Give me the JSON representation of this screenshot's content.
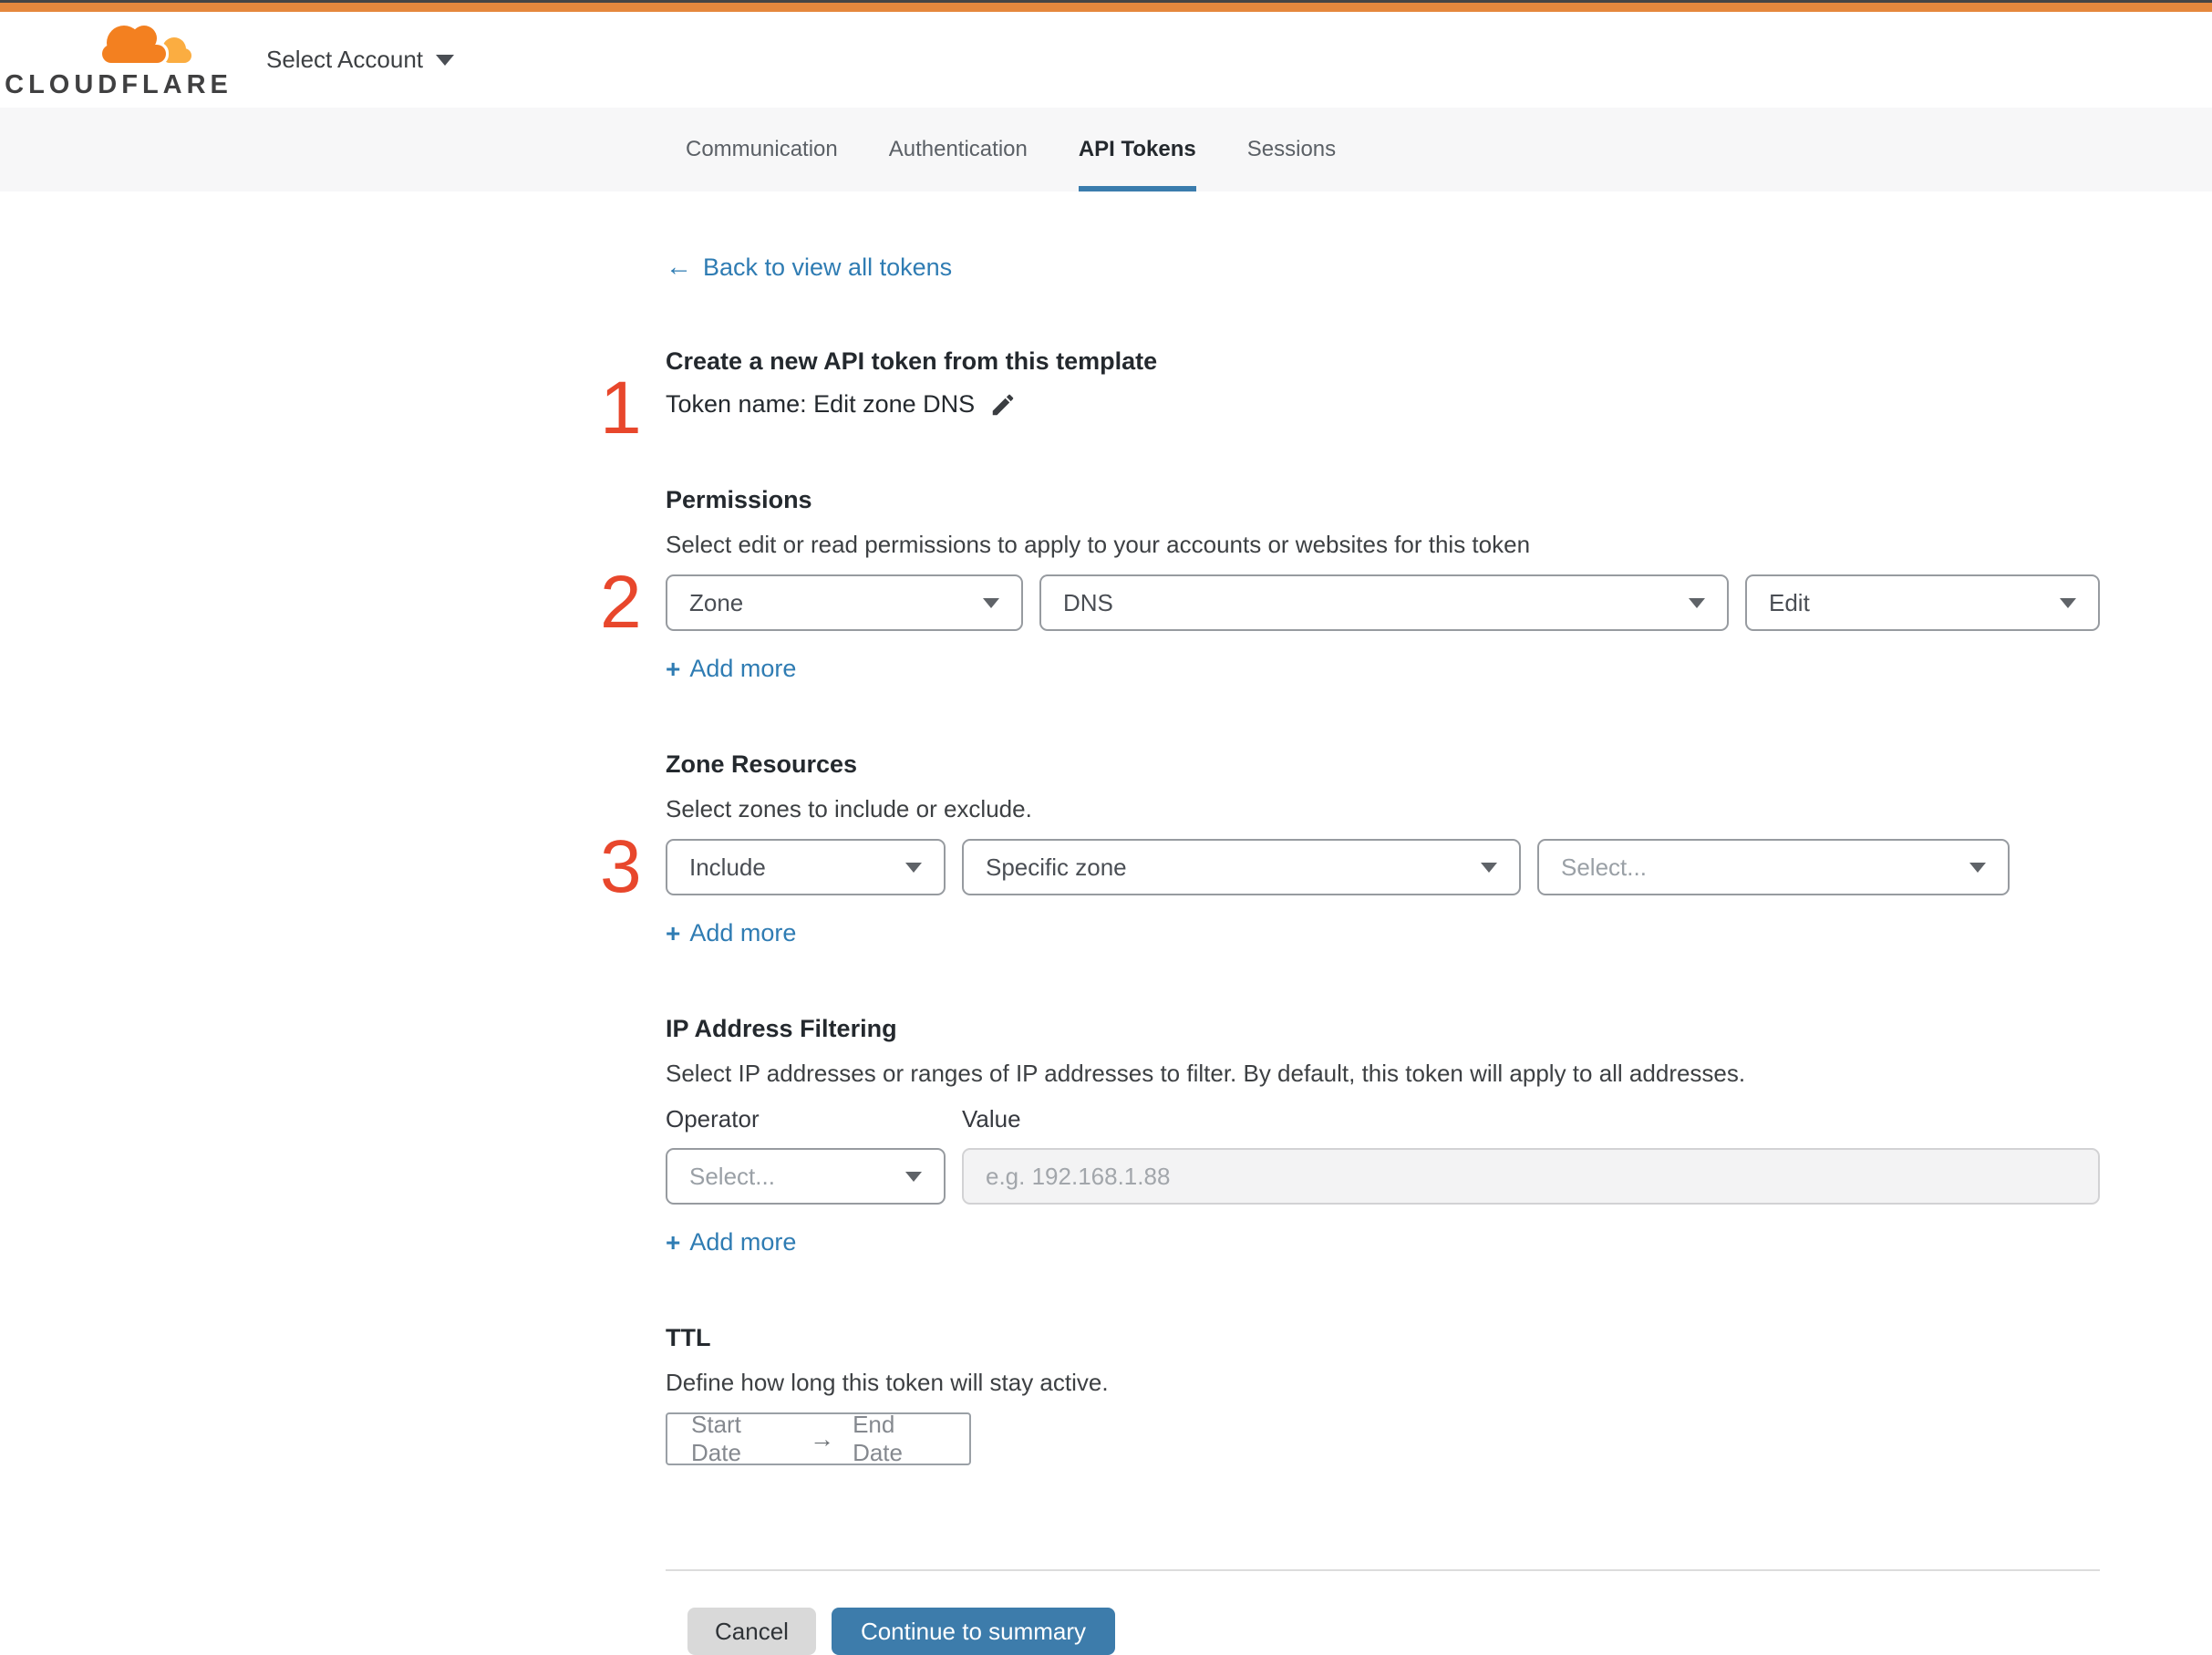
{
  "header": {
    "wordmark": "CLOUDFLARE",
    "account_selector": "Select Account"
  },
  "tabs": [
    {
      "label": "Communication",
      "active": false
    },
    {
      "label": "Authentication",
      "active": false
    },
    {
      "label": "API Tokens",
      "active": true
    },
    {
      "label": "Sessions",
      "active": false
    }
  ],
  "back_link": {
    "label": "Back to view all tokens"
  },
  "icons": {
    "back_arrow": "←",
    "plus": "+",
    "date_range_arrow": "→"
  },
  "template_section": {
    "step": "1",
    "title": "Create a new API token from this template",
    "token_name": "Token name: Edit zone DNS"
  },
  "permissions": {
    "step": "2",
    "title": "Permissions",
    "description": "Select edit or read permissions to apply to your accounts or websites for this token",
    "selects": [
      {
        "value": "Zone"
      },
      {
        "value": "DNS"
      },
      {
        "value": "Edit"
      }
    ],
    "add_more": "Add more"
  },
  "zone_resources": {
    "step": "3",
    "title": "Zone Resources",
    "description": "Select zones to include or exclude.",
    "selects": [
      {
        "value": "Include"
      },
      {
        "value": "Specific zone"
      },
      {
        "value": "Select..."
      }
    ],
    "add_more": "Add more"
  },
  "ip_filtering": {
    "title": "IP Address Filtering",
    "description": "Select IP addresses or ranges of IP addresses to filter. By default, this token will apply to all addresses.",
    "operator_label": "Operator",
    "value_label": "Value",
    "operator_select": "Select...",
    "value_placeholder": "e.g. 192.168.1.88",
    "add_more": "Add more"
  },
  "ttl": {
    "title": "TTL",
    "description": "Define how long this token will stay active.",
    "start_date": "Start Date",
    "end_date": "End Date"
  },
  "footer": {
    "cancel": "Cancel",
    "continue": "Continue to summary"
  },
  "colors": {
    "accent_orange": "#e5883d",
    "brand_orange": "#f38020",
    "brand_light_orange": "#fbad41",
    "link_blue": "#2f7cb3",
    "active_tab_blue": "#3a7cad",
    "primary_button_blue": "#3d7cab",
    "step_red": "#e8472c"
  }
}
